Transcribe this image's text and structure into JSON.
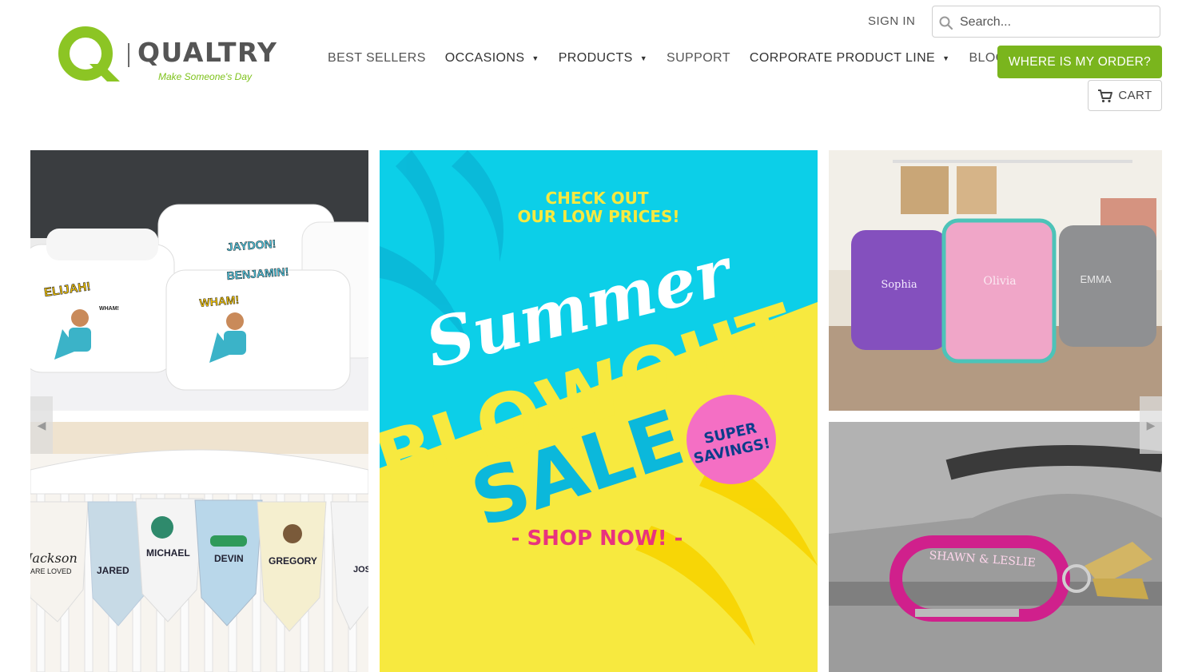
{
  "brand": {
    "name": "QUALTRY",
    "tagline": "Make Someone's Day",
    "green": "#7ab51d"
  },
  "header": {
    "sign_in": "SIGN IN",
    "search_placeholder": "Search...",
    "search_icon": "search-icon",
    "nav": [
      {
        "label": "BEST SELLERS",
        "dropdown": false
      },
      {
        "label": "OCCASIONS",
        "dropdown": true
      },
      {
        "label": "PRODUCTS",
        "dropdown": true
      },
      {
        "label": "SUPPORT",
        "dropdown": false
      },
      {
        "label": "CORPORATE PRODUCT LINE",
        "dropdown": true
      },
      {
        "label": "BLOG",
        "dropdown": false
      }
    ],
    "order_button": "WHERE IS MY ORDER?",
    "cart_label": "CART",
    "cart_icon": "cart-icon"
  },
  "tiles": {
    "pillows": {
      "names": [
        "ELIJAH!",
        "JAYDON!",
        "BENJAMIN!",
        "WHAM!"
      ]
    },
    "bibs": {
      "names": [
        "Jackson",
        "ARE LOVED",
        "JARED",
        "MICHAEL",
        "DEVIN",
        "GREGORY",
        "JOSH"
      ]
    },
    "promo": {
      "line1": "CHECK OUT",
      "line2": "OUR LOW PRICES!",
      "script": "Summer",
      "word1": "BLOWOUT",
      "word2": "SALE",
      "badge_line1": "SUPER",
      "badge_line2": "SAVINGS!",
      "cta": "- SHOP NOW! -"
    },
    "lunchbags": {
      "names": [
        "Sophia",
        "Olivia",
        "EMMA"
      ]
    },
    "carabiner": {
      "text": "SHAWN & LESLIE"
    }
  },
  "slider": {
    "prev_icon": "chevron-left-icon",
    "next_icon": "chevron-right-icon"
  }
}
